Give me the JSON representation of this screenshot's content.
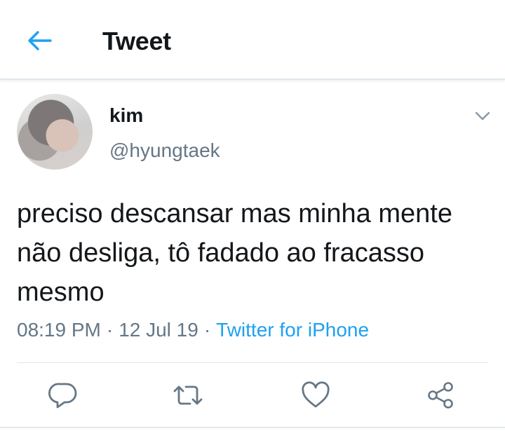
{
  "header": {
    "title": "Tweet",
    "back_icon": "back-arrow-icon"
  },
  "tweet": {
    "author": {
      "name": "kim",
      "handle": "@hyungtaek"
    },
    "text": "preciso descansar mas minha mente não desliga, tô fadado ao fracasso mesmo",
    "time": "08:19 PM",
    "separator": "·",
    "date": "12 Jul 19",
    "source": "Twitter for iPhone"
  },
  "actions": [
    {
      "name": "reply",
      "icon": "reply-icon"
    },
    {
      "name": "retweet",
      "icon": "retweet-icon"
    },
    {
      "name": "like",
      "icon": "heart-icon"
    },
    {
      "name": "share",
      "icon": "share-icon"
    }
  ],
  "colors": {
    "accent": "#1da1f2",
    "text": "#14171a",
    "muted": "#657786",
    "divider": "#e1e8ed"
  }
}
